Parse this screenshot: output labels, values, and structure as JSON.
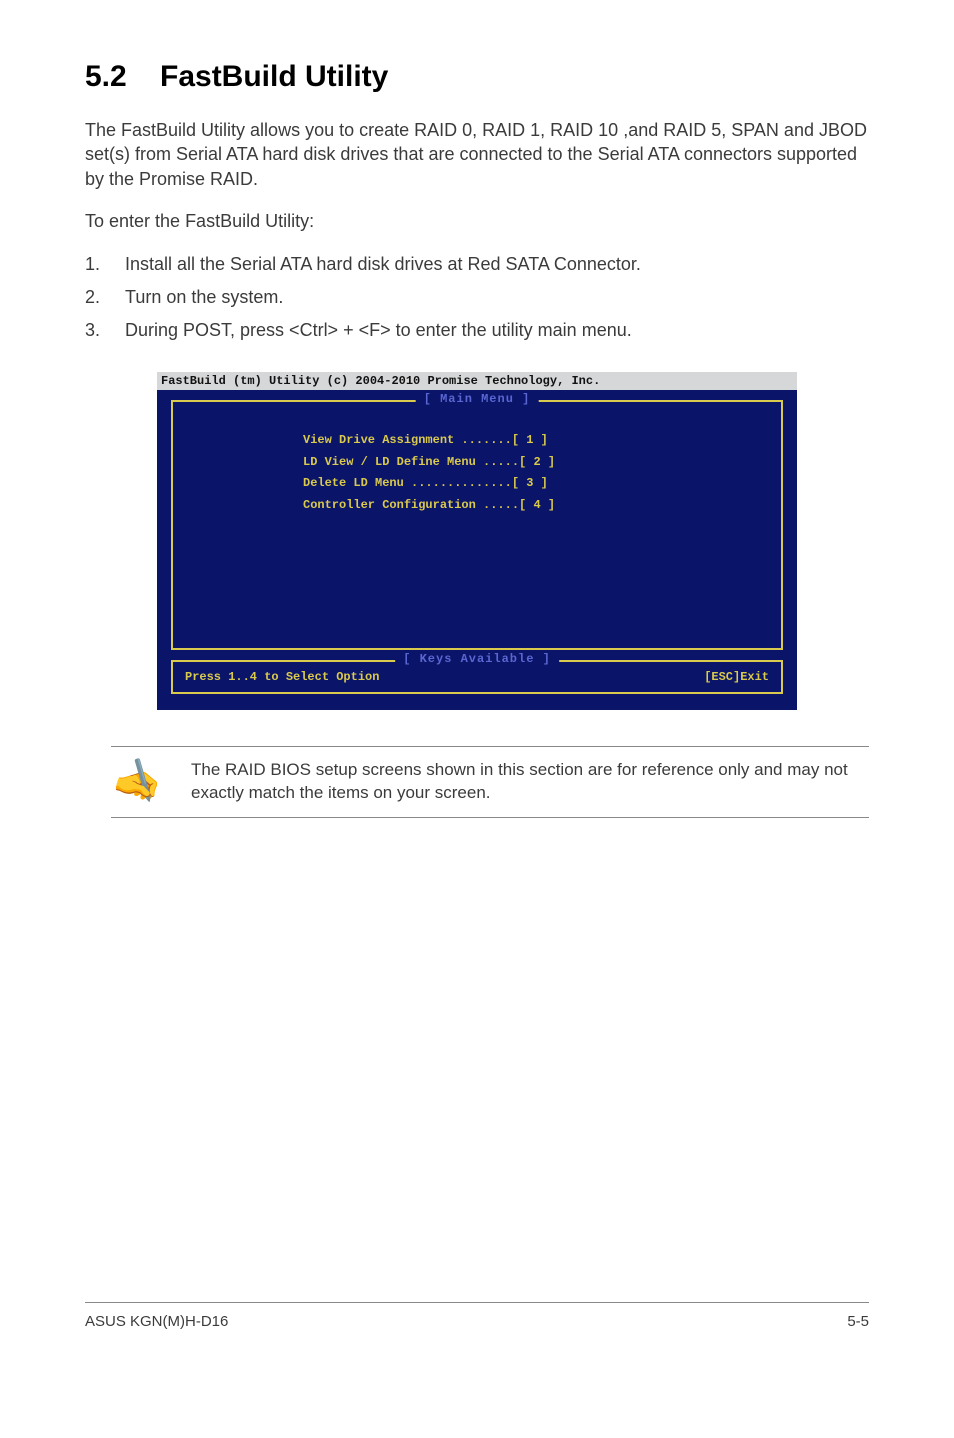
{
  "heading": {
    "number": "5.2",
    "title": "FastBuild Utility"
  },
  "paragraphs": {
    "intro": "The FastBuild Utility allows you to create RAID 0, RAID 1, RAID 10 ,and RAID 5, SPAN and JBOD set(s) from Serial ATA hard disk drives that are connected to the Serial ATA connectors supported by the Promise RAID.",
    "toEnter": "To enter the FastBuild Utility:"
  },
  "steps": [
    {
      "n": "1.",
      "t": "Install all the Serial ATA hard disk drives at Red SATA Connector."
    },
    {
      "n": "2.",
      "t": "Turn on the system."
    },
    {
      "n": "3.",
      "t": "During POST, press <Ctrl> + <F> to enter the utility main menu."
    }
  ],
  "bios": {
    "header": "FastBuild (tm) Utility (c) 2004-2010 Promise Technology, Inc.",
    "mainTitle": "[ Main Menu ]",
    "menu": [
      "View Drive Assignment  .......[ 1 ]",
      "LD View / LD Define Menu  .....[ 2 ]",
      "Delete LD Menu  ..............[ 3 ]",
      "Controller Configuration  .....[ 4 ]"
    ],
    "keysTitle": "[ Keys Available ]",
    "keysLeft": "Press 1..4 to Select Option",
    "keysRight": "[ESC]Exit"
  },
  "note": "The RAID BIOS setup screens shown in this section are for reference only and may not exactly match the items on your screen.",
  "footer": {
    "left": "ASUS KGN(M)H-D16",
    "right": "5-5"
  }
}
